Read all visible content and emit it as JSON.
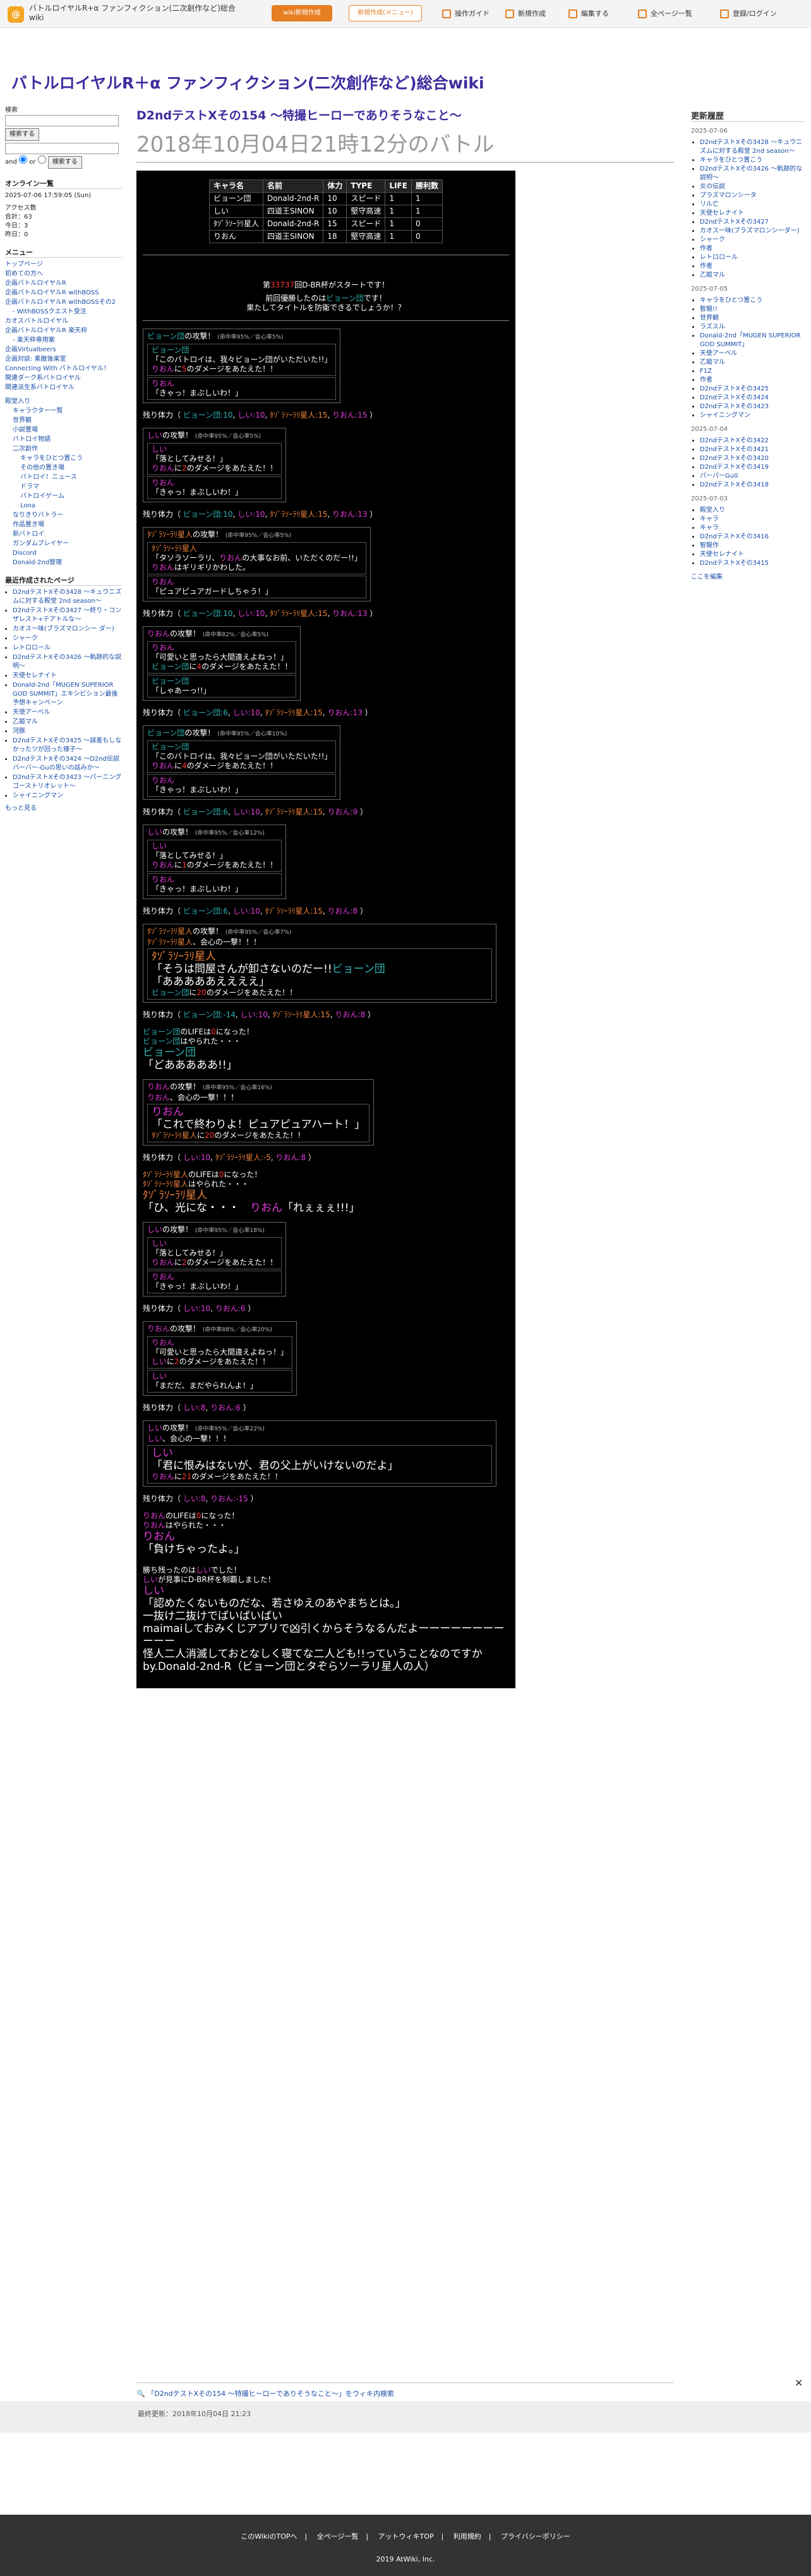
{
  "topbar": {
    "logo": "@",
    "site_name": "バトルロイヤルR+α ファンフィクション(二次創作など)総合wiki",
    "btn_a": "wiki新規作成",
    "btn_b": "新規作成(メニュー)",
    "nav": [
      "操作ガイド",
      "新規作成",
      "編集する",
      "全ページ一覧",
      "登録/ログイン"
    ]
  },
  "site_title": "バトルロイヤルR＋α ファンフィクション(二次創作など)総合wiki",
  "left": {
    "search_label": "検索",
    "search_btn": "検索する",
    "and": "and",
    "or": "or",
    "search_btn2": "検索する",
    "online": "オンライン一覧",
    "date": "2025-07-06 17:59:05 (Sun)",
    "access": [
      "アクセス数",
      "合計：63",
      "今日：3",
      "昨日：0"
    ],
    "menu_title": "メニュー",
    "menu": [
      "トップページ",
      "初めての方へ",
      "企画バトルロイヤルR",
      "企画バトルロイヤルR withBOSS",
      "企画バトルロイヤルR withBOSSその2",
      "- WithBOSSクエスト受注",
      "カオスバトルロイヤル",
      "企画バトルロイヤルR 楽天枠",
      "- 楽天枠専用案",
      "企画Virtualbeers",
      "企画対談: 素敵後楽室",
      "Connecting With バトルロイヤル！",
      "関連ダーク系バトロイヤル",
      "関連派生系バトロイヤル"
    ],
    "tree": [
      "殿堂入り",
      "キャラクター一覧",
      "世界観",
      "小説置場",
      "バトロイ物語",
      "二次創作",
      "キャラをひとつ置こう",
      "その他の置き場",
      "バトロイ！ニュース",
      "ドラマ",
      "バトロイゲーム",
      "Lona",
      "なりきりバトラー",
      "作品置き場",
      "新バトロイ",
      "ガンダムプレイヤー",
      "Discord",
      "Donald-2nd管理"
    ],
    "recent_title": "最近作成されたページ",
    "recent": [
      "D2ndテストXその3428 〜キュウニズムに対する殿堂 2nd season〜",
      "D2ndテストXその3427 〜終り・コンザレスト+テアトルな〜",
      "カオス一味(ブラズマロンシー ダー)",
      "シャーク",
      "レトロロール",
      "D2ndテストXその3426 〜軌跡的な説明〜",
      "天使セレナイト",
      "Donald-2nd「MUGEN SUPERIOR GOD SUMMIT」エキシビション最後予想キャンペーン",
      "天使アーベル",
      "乙姫マル",
      "河豚",
      "D2ndテストXその3425 〜誤差もしなかったツが回った様子〜",
      "D2ndテストXその3424 〜D2nd伝説バーバー-Guの思いの話みか〜",
      "D2ndテストXその3423 〜パーニングゴーストリオレット〜",
      "シャイニングマン"
    ],
    "more": "もっと見る"
  },
  "main": {
    "h1": "D2ndテストXその154 〜特撮ヒーローでありそうなこと〜",
    "h2": "2018年10月04日21時12分のバトル",
    "table": {
      "head": [
        "キャラ名",
        "名前",
        "体力",
        "TYPE",
        "LIFE",
        "勝利数"
      ],
      "rows": [
        [
          "ビョーン団",
          "Donald-2nd-R",
          "10",
          "スピード",
          "1",
          "1"
        ],
        [
          "しい",
          "四道王SINON",
          "10",
          "堅守高速",
          "1",
          "1"
        ],
        [
          "ﾀｿﾞﾗｿｰﾗﾘ星人",
          "Donald-2nd-R",
          "15",
          "スピード",
          "1",
          "0"
        ],
        [
          "りおん",
          "四道王SINON",
          "18",
          "堅守高速",
          "1",
          "0"
        ]
      ]
    },
    "start1": "第",
    "start_num": "33737",
    "start2": "回D-BR杯がスタートです！",
    "prev1": "前回優勝したのは",
    "prev2": "ビョーン団",
    "prev3": "です！",
    "prev4": "果たしてタイトルを防衛できるでしょうか！？",
    "hp_label": "残り体力（",
    "hp_close": "）",
    "big1": "「そうは問屋さんが卸さないのだー!!",
    "big1b": "ビョーン団",
    "big2": "「あああああええええ」",
    "win_note": "勝ち残ったのは",
    "win_tail": "が見事にD-BR杯を制覇しました！",
    "epilogue": [
      "「認めたくないものだな、若さゆえのあやまちとは。」",
      "一抜け二抜けでばいばいばい",
      "maimaiしておみくじアプリで凶引くからそうなるんだよーーーーーーーーーーー",
      "怪人二人消滅しておとなしく寝てな二人ども!!っていうことなのですか",
      "by.Donald-2nd-R（ビョーン団とタぞらソーラリ星人の人）"
    ]
  },
  "right": {
    "title": "更新履歴",
    "days": [
      {
        "date": "2025-07-06",
        "items": [
          "D2ndテストXその3428 〜キュウニズムに対する殿堂 2nd season〜",
          "キャラをひとつ置こう",
          "D2ndテストXその3426 〜軌跡的な説明〜",
          "炎の伝説",
          "プラズマロンシータ",
          "リル亡",
          "天使セレナイト",
          "D2ndテストXその3427",
          "カオス一味(ブラズマロンシーダー)",
          "シャーク",
          "作者",
          "レトロロール",
          "作者",
          "乙姫マル"
        ]
      },
      {
        "date": "2025-07-05",
        "items": [
          "キャラをひとつ置こう",
          "智龍!!",
          "世界観",
          "ラズスル",
          "Donald-2nd「MUGEN SUPERIOR GOD SUMMIT」",
          "天使アーベル",
          "乙姫マル",
          "F1Z",
          "作者",
          "D2ndテストXその3425",
          "D2ndテストXその3424",
          "D2ndテストXその3423",
          "シャイニングマン"
        ]
      },
      {
        "date": "2025-07-04",
        "items": [
          "D2ndテストXその3422",
          "D2ndテストXその3421",
          "D2ndテストXその3420",
          "D2ndテストXその3419",
          "パーパーGu0",
          "D2ndテストXその3418"
        ]
      },
      {
        "date": "2025-07-03",
        "items": [
          "殿堂入り",
          "キャラ",
          "キャラ",
          "D2ndテストXその3416",
          "智龍作",
          "天使セレナイト",
          "D2ndテストXその3415"
        ]
      }
    ],
    "more": "ここを編集"
  },
  "footline": "「D2ndテストXその154 〜特撮ヒーローでありそうなこと〜」をウィキ内検索",
  "updated": "最終更新：2018年10月04日 21:23",
  "footer": {
    "links": [
      "このWikiのTOPへ",
      "全ページ一覧",
      "アットウィキTOP",
      "利用規約",
      "プライバシーポリシー"
    ],
    "copyright": "2019 AtWiki, Inc."
  }
}
